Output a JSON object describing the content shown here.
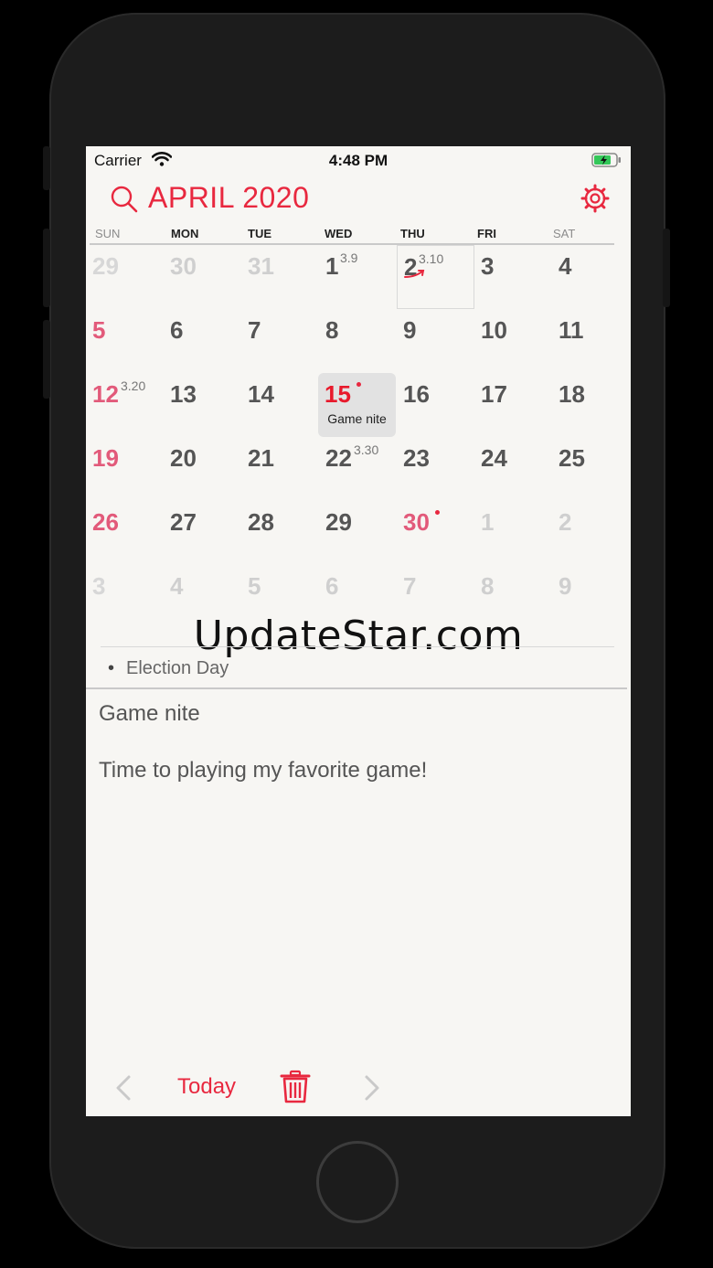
{
  "status": {
    "carrier": "Carrier",
    "time": "4:48 PM"
  },
  "header": {
    "title": "APRIL 2020"
  },
  "weekdays": [
    "SUN",
    "MON",
    "TUE",
    "WED",
    "THU",
    "FRI",
    "SAT"
  ],
  "weeks": [
    [
      {
        "day": "29",
        "state": "faded"
      },
      {
        "day": "30",
        "state": "faded"
      },
      {
        "day": "31",
        "state": "faded"
      },
      {
        "day": "1",
        "lunar": "3.9"
      },
      {
        "day": "2",
        "lunar": "3.10",
        "today": true
      },
      {
        "day": "3"
      },
      {
        "day": "4"
      }
    ],
    [
      {
        "day": "5",
        "state": "pink"
      },
      {
        "day": "6"
      },
      {
        "day": "7"
      },
      {
        "day": "8"
      },
      {
        "day": "9"
      },
      {
        "day": "10"
      },
      {
        "day": "11"
      }
    ],
    [
      {
        "day": "12",
        "state": "pink",
        "lunar": "3.20"
      },
      {
        "day": "13"
      },
      {
        "day": "14"
      },
      {
        "day": "15",
        "state": "red",
        "dot": true,
        "selected": true,
        "event": "Game nite"
      },
      {
        "day": "16"
      },
      {
        "day": "17"
      },
      {
        "day": "18"
      }
    ],
    [
      {
        "day": "19",
        "state": "pink"
      },
      {
        "day": "20"
      },
      {
        "day": "21"
      },
      {
        "day": "22",
        "lunar": "3.30"
      },
      {
        "day": "23"
      },
      {
        "day": "24"
      },
      {
        "day": "25"
      }
    ],
    [
      {
        "day": "26",
        "state": "pink"
      },
      {
        "day": "27"
      },
      {
        "day": "28"
      },
      {
        "day": "29"
      },
      {
        "day": "30",
        "state": "pink",
        "dot": true
      },
      {
        "day": "1",
        "state": "faded"
      },
      {
        "day": "2",
        "state": "faded"
      }
    ],
    [
      {
        "day": "3",
        "state": "faded"
      },
      {
        "day": "4",
        "state": "faded"
      },
      {
        "day": "5",
        "state": "faded"
      },
      {
        "day": "6",
        "state": "faded"
      },
      {
        "day": "7",
        "state": "faded"
      },
      {
        "day": "8",
        "state": "faded"
      },
      {
        "day": "9",
        "state": "faded"
      }
    ]
  ],
  "events": {
    "holiday": "Election Day"
  },
  "watermark": "UpdateStar.com",
  "note": {
    "title": "Game nite",
    "body": "Time to playing my favorite game!"
  },
  "toolbar": {
    "today_label": "Today"
  },
  "colors": {
    "accent": "#e8283f",
    "sunday": "#e25a7a",
    "battery": "#34c759"
  }
}
